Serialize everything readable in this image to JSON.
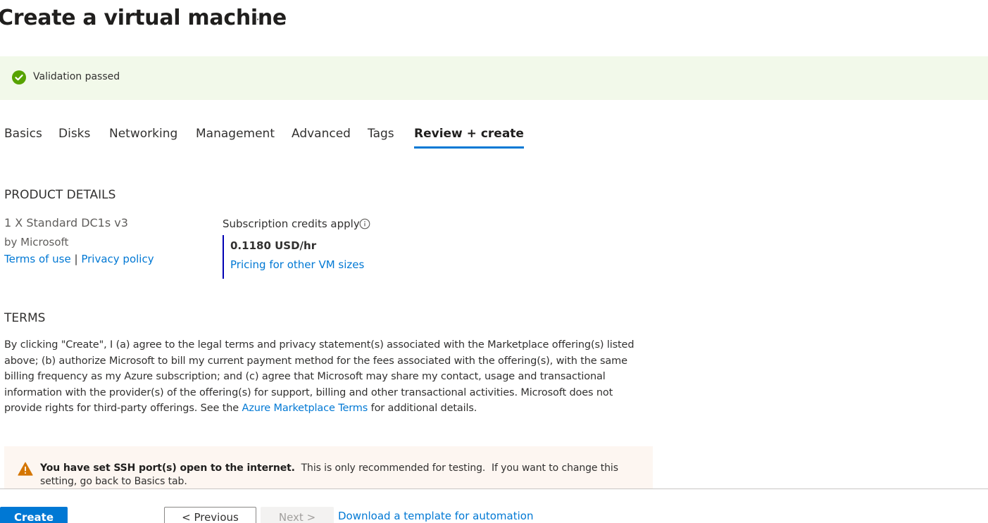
{
  "page": {
    "title": "Create a virtual machine",
    "more_label": "···"
  },
  "validation": {
    "icon": "check-circle-icon",
    "text": "Validation passed",
    "color": "#57a300"
  },
  "tabs": [
    {
      "label": "Basics",
      "active": false
    },
    {
      "label": "Disks",
      "active": false
    },
    {
      "label": "Networking",
      "active": false
    },
    {
      "label": "Management",
      "active": false
    },
    {
      "label": "Advanced",
      "active": false
    },
    {
      "label": "Tags",
      "active": false
    },
    {
      "label": "Review + create",
      "active": true
    }
  ],
  "product": {
    "heading": "PRODUCT DETAILS",
    "name": "1 X Standard DC1s v3",
    "publisher": "by Microsoft",
    "terms_link": "Terms of use",
    "separator": "|",
    "privacy_link": "Privacy policy",
    "credits_label": "Subscription credits apply",
    "price": "0.1180 USD/hr",
    "pricing_link": "Pricing for other VM sizes"
  },
  "terms": {
    "heading": "TERMS",
    "text_before": "By clicking \"Create\", I (a) agree to the legal terms and privacy statement(s) associated with the Marketplace offering(s) listed above; (b) authorize Microsoft to bill my current payment method for the fees associated with the offering(s), with the same billing frequency as my Azure subscription; and (c) agree that Microsoft may share my contact, usage and transactional information with the provider(s) of the offering(s) for support, billing and other transactional activities. Microsoft does not provide rights for third-party offerings. See the ",
    "link": "Azure Marketplace Terms",
    "text_after": " for additional details."
  },
  "warning": {
    "icon": "warning-icon",
    "bold": "You have set SSH port(s) open to the internet.",
    "text": "  This is only recommended for testing.  If you want to change this setting, go back to Basics tab.",
    "color": "#d47500"
  },
  "footer": {
    "create_label": "Create",
    "previous_label": "< Previous",
    "next_label": "Next >",
    "download_link": "Download a template for automation"
  },
  "colors": {
    "accent": "#0078d4",
    "price_border": "#0000b4",
    "validation_bg": "#f2f9ea",
    "warning_bg": "#fdf6f1"
  }
}
